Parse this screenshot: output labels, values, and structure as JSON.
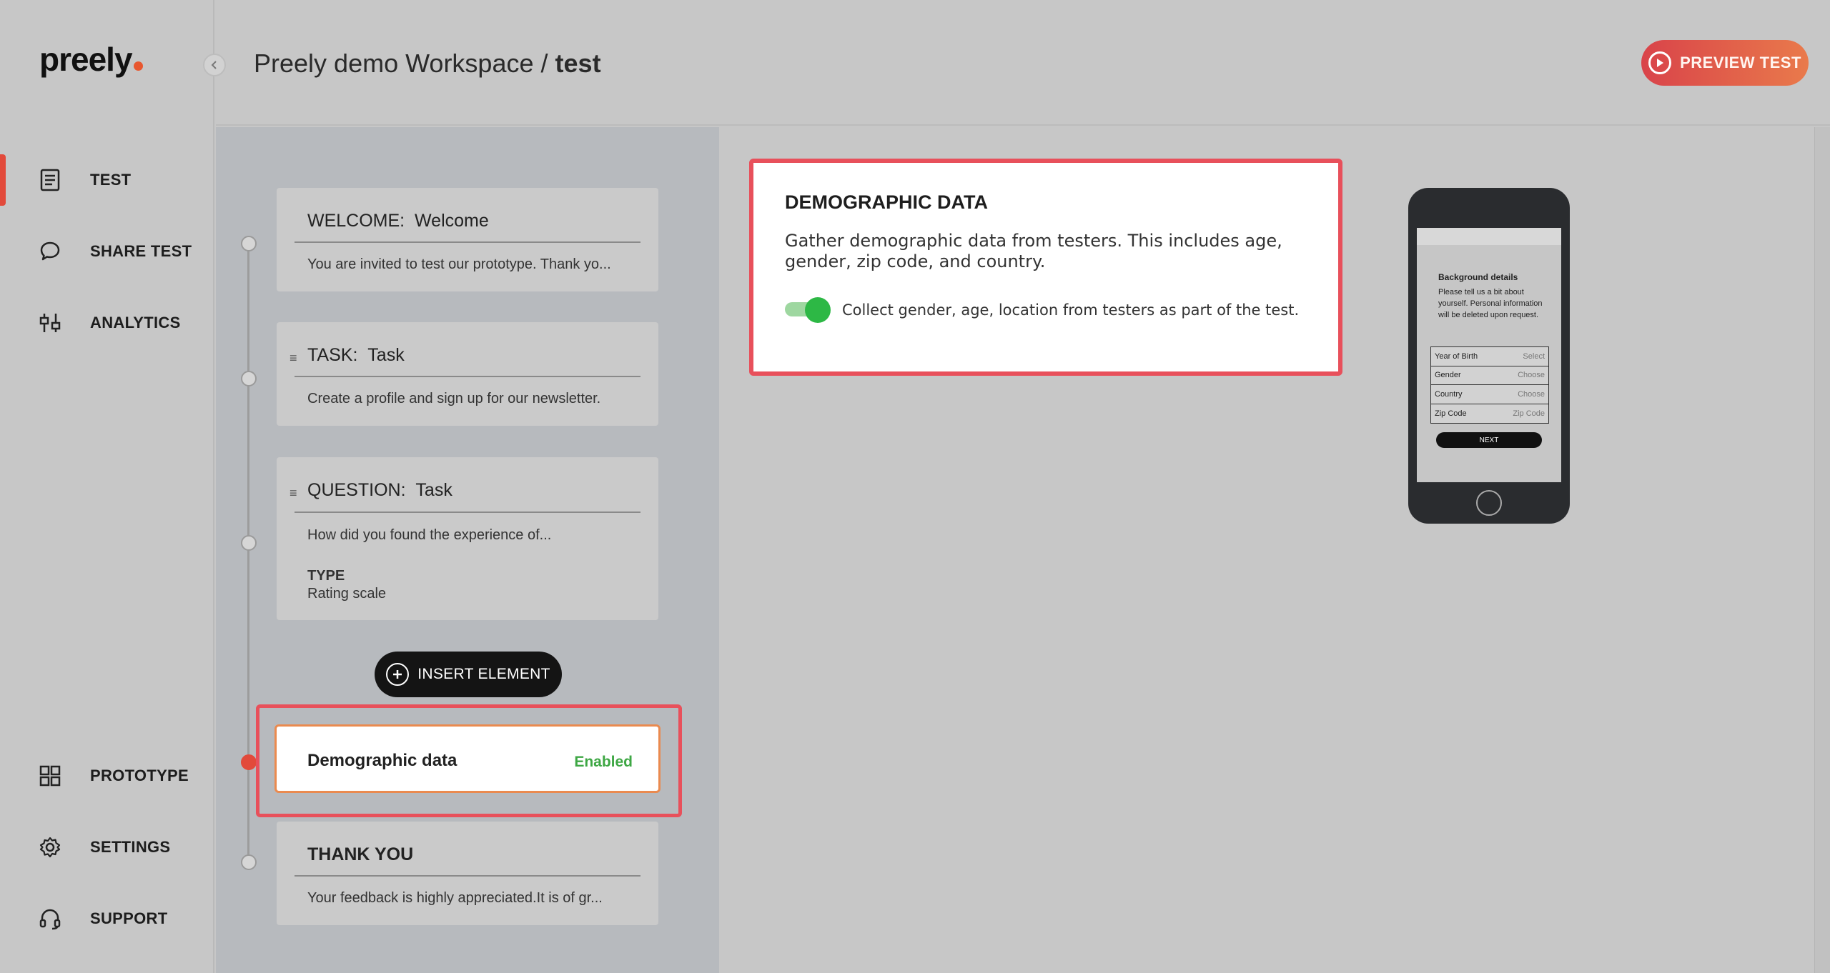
{
  "brand": {
    "logo_text": "preely"
  },
  "sidebar": {
    "collapse_icon": "chevron-left-icon",
    "top_items": [
      {
        "label": "TEST",
        "icon": "document-icon",
        "active": true
      },
      {
        "label": "SHARE TEST",
        "icon": "chat-bubble-icon",
        "active": false
      },
      {
        "label": "ANALYTICS",
        "icon": "sliders-icon",
        "active": false
      }
    ],
    "bottom_items": [
      {
        "label": "PROTOTYPE",
        "icon": "grid-icon"
      },
      {
        "label": "SETTINGS",
        "icon": "gear-icon"
      },
      {
        "label": "SUPPORT",
        "icon": "headset-icon"
      }
    ]
  },
  "header": {
    "workspace": "Preely demo Workspace",
    "separator": "/",
    "test_name": "test",
    "preview_label": "PREVIEW TEST"
  },
  "flow": {
    "cards": [
      {
        "kind": "WELCOME:",
        "name": "Welcome",
        "body": "You are invited to test our prototype. Thank yo..."
      },
      {
        "kind": "TASK:",
        "name": "Task",
        "body": "Create a profile and sign up for our newsletter."
      },
      {
        "kind": "QUESTION:",
        "name": "Task",
        "body": "How did you found the experience of...",
        "type_label": "TYPE",
        "type_value": "Rating scale"
      }
    ],
    "insert_label": "INSERT ELEMENT",
    "demographic": {
      "name": "Demographic data",
      "status": "Enabled"
    },
    "thank_you": {
      "kind": "THANK YOU",
      "body": "Your feedback is highly appreciated.It is of gr..."
    }
  },
  "settings": {
    "title": "DEMOGRAPHIC DATA",
    "description": "Gather demographic data from testers. This includes age, gender, zip code, and country.",
    "toggle_on": true,
    "toggle_label": "Collect gender, age, location from testers as part of the test."
  },
  "phone_preview": {
    "title": "Background details",
    "text": "Please tell us a bit about yourself. Personal information will be deleted upon request.",
    "rows": [
      {
        "label": "Year of Birth",
        "value": "Select"
      },
      {
        "label": "Gender",
        "value": "Choose"
      },
      {
        "label": "Country",
        "value": "Choose"
      },
      {
        "label": "Zip Code",
        "value": "Zip Code"
      }
    ],
    "next_label": "NEXT"
  },
  "colors": {
    "accent_red": "#e24a3b",
    "highlight_border": "#e8505b",
    "enabled_green": "#3ea744",
    "toggle_green": "#2db845"
  }
}
